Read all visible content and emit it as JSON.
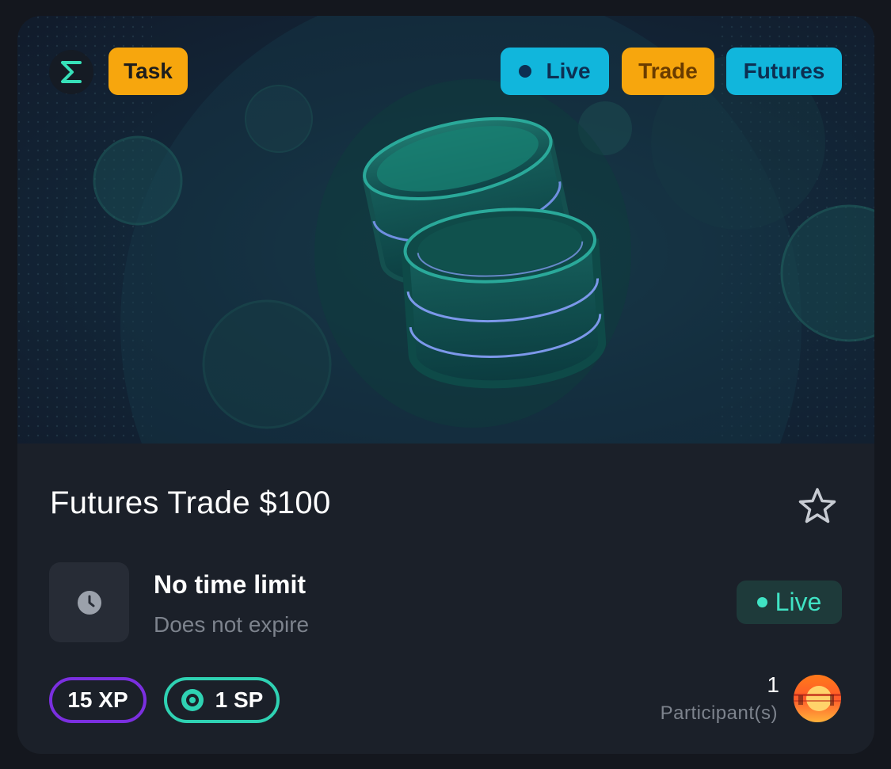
{
  "hero": {
    "icon": "coin-stack-illustration"
  },
  "header": {
    "logo_icon": "sigma-icon",
    "category": "Task",
    "tags": [
      "Live",
      "Trade",
      "Futures"
    ]
  },
  "task": {
    "title": "Futures Trade $100",
    "favorite_icon": "star-icon"
  },
  "time": {
    "icon": "clock-icon",
    "title": "No time limit",
    "subtitle": "Does not expire"
  },
  "status": {
    "label": "Live",
    "color": "#40e3c4"
  },
  "rewards": {
    "xp": "15 XP",
    "xp_color": "#7b2fe0",
    "sp": "1 SP",
    "sp_color": "#2fd2b3",
    "sp_icon": "sp-coin-icon"
  },
  "participants": {
    "count": "1",
    "label": "Participant(s)"
  },
  "colors": {
    "accent_orange": "#f7a60d",
    "accent_cyan": "#11b6dc",
    "card_bg": "#1b2029"
  }
}
